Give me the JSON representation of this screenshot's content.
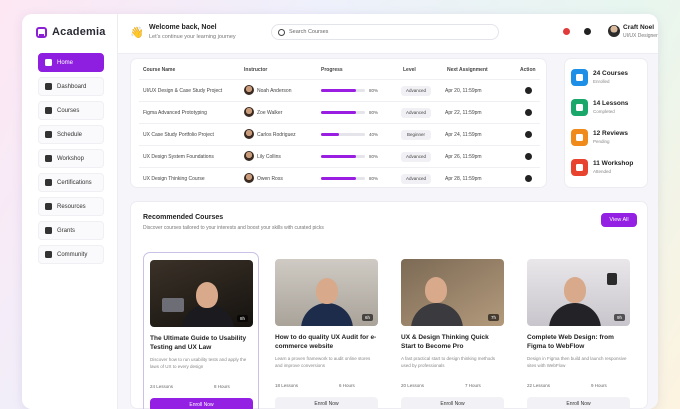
{
  "app": {
    "name": "Academia"
  },
  "sidebar": {
    "items": [
      {
        "label": "Home",
        "active": true
      },
      {
        "label": "Dashboard"
      },
      {
        "label": "Courses"
      },
      {
        "label": "Schedule"
      },
      {
        "label": "Workshop"
      },
      {
        "label": "Certifications"
      },
      {
        "label": "Resources"
      },
      {
        "label": "Grants"
      },
      {
        "label": "Community"
      }
    ]
  },
  "header": {
    "welcome_title": "Welcome back, Noel",
    "welcome_sub": "Let's continue your learning journey",
    "search_placeholder": "Search Courses",
    "user_name": "Craft Noel",
    "user_role": "UI/UX Designer"
  },
  "table": {
    "columns": [
      "Course Name",
      "Instructor",
      "Progress",
      "Level",
      "Next Assignment",
      "Action"
    ],
    "rows": [
      {
        "course": "UI/UX Design & Case Study Project",
        "instructor": "Noah Anderson",
        "progress": 80,
        "progress_label": "80%",
        "level": "Advanced",
        "next": "Apr 20, 11:59pm"
      },
      {
        "course": "Figma Advanced Prototyping",
        "instructor": "Zoe Walker",
        "progress": 80,
        "progress_label": "80%",
        "level": "Advanced",
        "next": "Apr 22, 11:59pm"
      },
      {
        "course": "UX Case Study Portfolio Project",
        "instructor": "Carlos Rodriguez",
        "progress": 40,
        "progress_label": "40%",
        "level": "Beginner",
        "next": "Apr 24, 11:59pm"
      },
      {
        "course": "UX Design System Foundations",
        "instructor": "Lily Collins",
        "progress": 80,
        "progress_label": "80%",
        "level": "Advanced",
        "next": "Apr 26, 11:59pm"
      },
      {
        "course": "UX Design Thinking Course",
        "instructor": "Owen Ross",
        "progress": 80,
        "progress_label": "80%",
        "level": "Advanced",
        "next": "Apr 28, 11:59pm"
      }
    ]
  },
  "stats": [
    {
      "value": "24 Courses",
      "sub": "Enrolled",
      "color": "#1d8fe6"
    },
    {
      "value": "14 Lessons",
      "sub": "Completed",
      "color": "#19a86a"
    },
    {
      "value": "12 Reviews",
      "sub": "Pending",
      "color": "#f08a1a"
    },
    {
      "value": "11 Workshop",
      "sub": "Attended",
      "color": "#e8432f"
    }
  ],
  "recommended": {
    "title": "Recommended Courses",
    "subtitle": "Discover courses tailored to your interests and boost your skills with curated picks",
    "view_all": "View All",
    "courses": [
      {
        "title": "The Ultimate Guide to Usability Testing and UX Law",
        "desc": "Discover how to run usability tests and apply the laws of UX to every design",
        "lessons": "24 Lessons",
        "duration": "8 Hours",
        "badge": "8h",
        "button": "Enroll Now",
        "selected": true
      },
      {
        "title": "How to do quality UX Audit for e-commerce website",
        "desc": "Learn a proven framework to audit online stores and improve conversions",
        "lessons": "18 Lessons",
        "duration": "6 Hours",
        "badge": "6h",
        "button": "Enroll Now",
        "selected": false
      },
      {
        "title": "UX & Design Thinking Quick Start to Become Pro",
        "desc": "A fast practical start to design thinking methods used by professionals",
        "lessons": "20 Lessons",
        "duration": "7 Hours",
        "badge": "7h",
        "button": "Enroll Now",
        "selected": false
      },
      {
        "title": "Complete Web Design: from Figma to WebFlow",
        "desc": "Design in Figma then build and launch responsive sites with WebFlow",
        "lessons": "22 Lessons",
        "duration": "9 Hours",
        "badge": "9h",
        "button": "Enroll Now",
        "selected": false
      }
    ]
  },
  "colors": {
    "accent": "#9420e4"
  }
}
